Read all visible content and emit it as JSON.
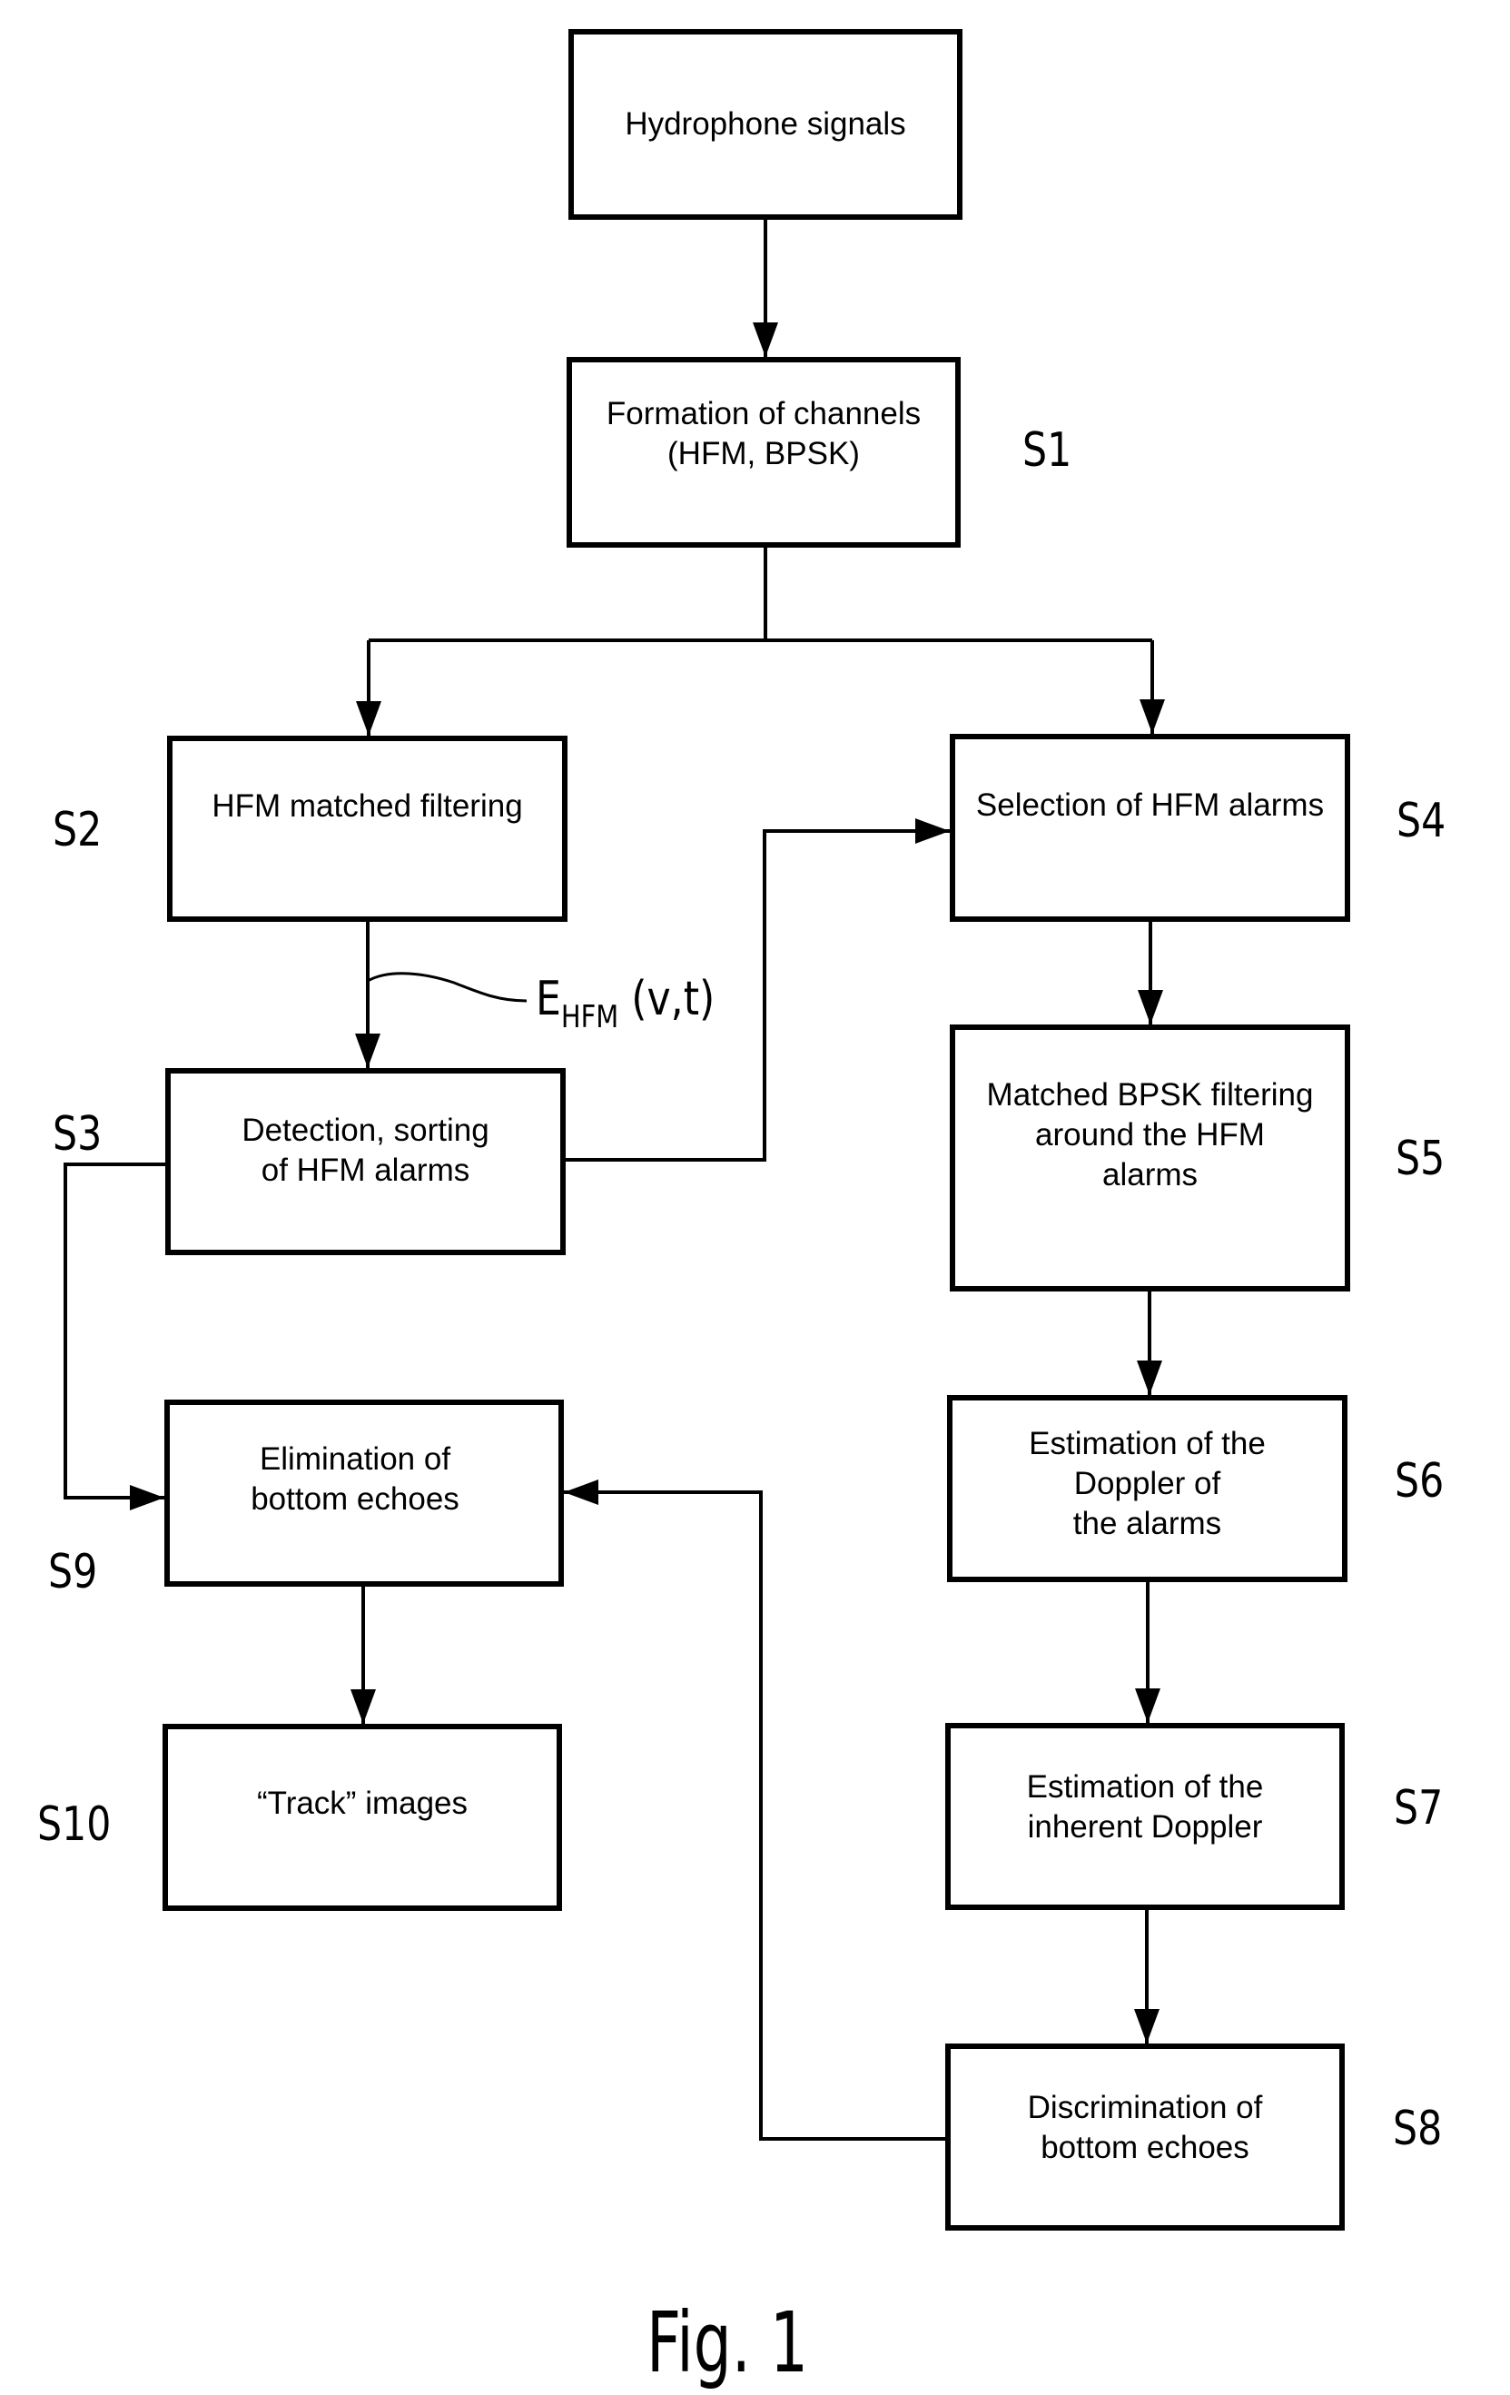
{
  "figure": {
    "caption": "Fig. 1",
    "annotation": {
      "symbol": "E",
      "subscript": "HFM",
      "args": "(v,t)"
    },
    "colors": {
      "line": "#000000",
      "background": "#ffffff"
    }
  },
  "nodes": [
    {
      "id": "hydrophone",
      "step": "",
      "text": "Hydrophone signals"
    },
    {
      "id": "s1",
      "step": "S1",
      "text": "Formation of channels\n(HFM, BPSK)"
    },
    {
      "id": "s2",
      "step": "S2",
      "text": "HFM matched filtering"
    },
    {
      "id": "s3",
      "step": "S3",
      "text": "Detection, sorting\nof HFM alarms"
    },
    {
      "id": "s4",
      "step": "S4",
      "text": "Selection of HFM alarms"
    },
    {
      "id": "s5",
      "step": "S5",
      "text": "Matched BPSK filtering\naround the HFM\nalarms"
    },
    {
      "id": "s6",
      "step": "S6",
      "text": "Estimation of the\nDoppler of\nthe alarms"
    },
    {
      "id": "s7",
      "step": "S7",
      "text": "Estimation of the\ninherent Doppler"
    },
    {
      "id": "s8",
      "step": "S8",
      "text": "Discrimination of\nbottom echoes"
    },
    {
      "id": "s9",
      "step": "S9",
      "text": "Elimination of\nbottom echoes"
    },
    {
      "id": "s10",
      "step": "S10",
      "text": "“Track” images"
    }
  ],
  "edges": [
    {
      "from": "hydrophone",
      "to": "s1"
    },
    {
      "from": "s1",
      "to": "s2"
    },
    {
      "from": "s1",
      "to": "s4"
    },
    {
      "from": "s2",
      "to": "s3",
      "label": "E_HFM(v,t)"
    },
    {
      "from": "s3",
      "to": "s4"
    },
    {
      "from": "s3",
      "to": "s9"
    },
    {
      "from": "s4",
      "to": "s5"
    },
    {
      "from": "s5",
      "to": "s6"
    },
    {
      "from": "s6",
      "to": "s7"
    },
    {
      "from": "s7",
      "to": "s8"
    },
    {
      "from": "s8",
      "to": "s9"
    },
    {
      "from": "s9",
      "to": "s10"
    }
  ]
}
